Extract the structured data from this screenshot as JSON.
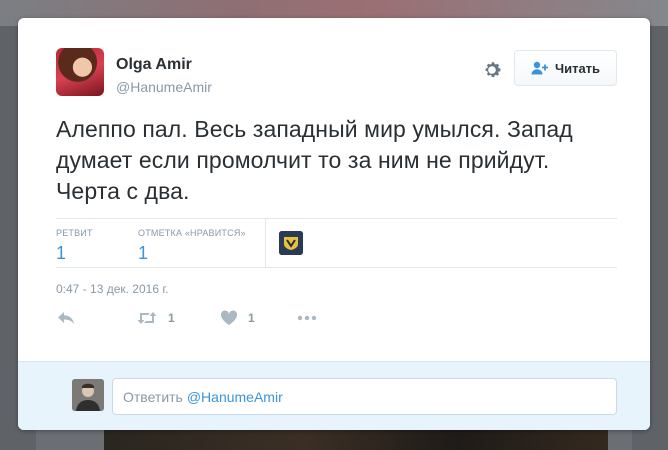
{
  "tweet": {
    "author_name": "Olga Amir",
    "author_handle": "@HanumeAmir",
    "text": "Алеппо пал. Весь западный мир умылся. Запад думает если промолчит то за ним не прийдут. Черта с два.",
    "follow_label": "Читать",
    "timestamp": "0:47 - 13 дек. 2016 г."
  },
  "stats": {
    "retweets_label": "РЕТВИТ",
    "retweets_value": "1",
    "likes_label": "ОТМЕТКА «НРАВИТСЯ»",
    "likes_value": "1"
  },
  "actions": {
    "retweet_count": "1",
    "like_count": "1"
  },
  "reply": {
    "prefix": "Ответить",
    "mention": "@HanumeAmir"
  },
  "colors": {
    "accent": "#3b94d9",
    "muted": "#8899a6",
    "text": "#292f33",
    "reply_bg": "#e8f4fb"
  },
  "icons": [
    "gear-icon",
    "follow-user-icon",
    "reply-icon",
    "retweet-icon",
    "heart-icon",
    "more-icon"
  ]
}
